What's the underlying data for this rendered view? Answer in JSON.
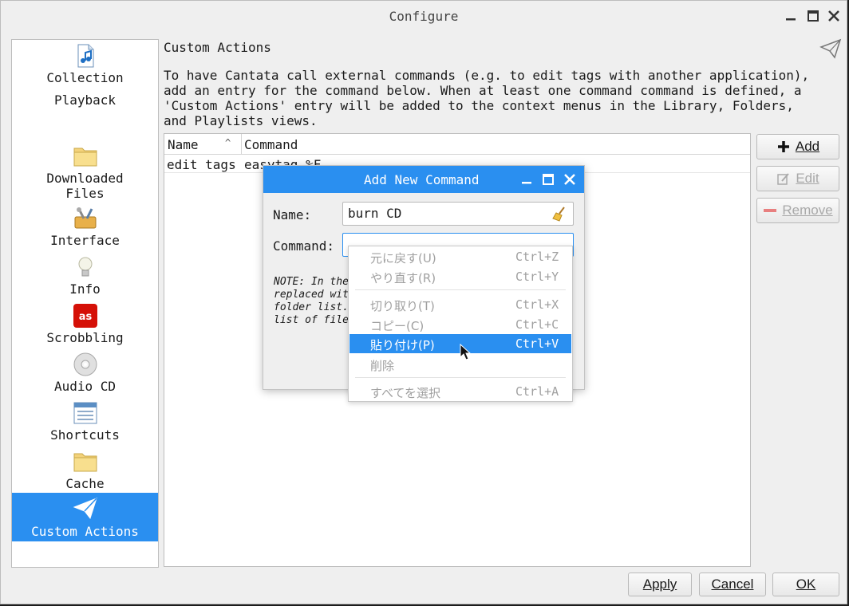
{
  "window": {
    "title": "Configure"
  },
  "sidebar": {
    "items": [
      {
        "label": "Collection",
        "icon": "music-file-icon"
      },
      {
        "label": "Playback",
        "icon": "playback-icon"
      },
      {
        "label": "Downloaded\nFiles",
        "icon": "folder-icon"
      },
      {
        "label": "Interface",
        "icon": "tools-icon"
      },
      {
        "label": "Info",
        "icon": "lightbulb-icon"
      },
      {
        "label": "Scrobbling",
        "icon": "lastfm-icon"
      },
      {
        "label": "Audio CD",
        "icon": "cd-icon"
      },
      {
        "label": "Shortcuts",
        "icon": "shortcuts-icon"
      },
      {
        "label": "Cache",
        "icon": "folder-icon"
      },
      {
        "label": "Custom Actions",
        "icon": "paper-plane-icon"
      }
    ]
  },
  "page": {
    "title": "Custom Actions",
    "description": [
      "To have Cantata call external commands (e.g. to edit tags with another application),",
      "add an entry for the command below. When at least one command command is defined, a",
      "'Custom Actions' entry will be added to the context menus in the Library, Folders,",
      "and Playlists views."
    ]
  },
  "table": {
    "columns": [
      "Name",
      "Command"
    ],
    "rows": [
      {
        "name": "edit tags",
        "command": "easytag %F"
      }
    ]
  },
  "side_buttons": {
    "add": "Add",
    "edit": "Edit",
    "remove": "Remove"
  },
  "bottom_buttons": {
    "apply": "Apply",
    "cancel": "Cancel",
    "ok": "OK"
  },
  "dialog": {
    "title": "Add New Command",
    "name_label": "Name:",
    "name_value": "burn CD",
    "command_label": "Command:",
    "command_value": "",
    "note_lines": [
      "NOTE: In the",
      "replaced wit",
      "folder list.",
      "list of file"
    ]
  },
  "context_menu": {
    "items": [
      {
        "label": "元に戻す(U)",
        "shortcut": "Ctrl+Z"
      },
      {
        "label": "やり直す(R)",
        "shortcut": "Ctrl+Y"
      },
      {
        "label": "切り取り(T)",
        "shortcut": "Ctrl+X"
      },
      {
        "label": "コピー(C)",
        "shortcut": "Ctrl+C"
      },
      {
        "label": "貼り付け(P)",
        "shortcut": "Ctrl+V"
      },
      {
        "label": "削除",
        "shortcut": ""
      },
      {
        "label": "すべてを選択",
        "shortcut": "Ctrl+A"
      }
    ],
    "highlighted": "貼り付け(P)"
  },
  "colors": {
    "accent": "#2a8ff0",
    "window_bg": "#efefef",
    "disabled_text": "#a0a0a0"
  }
}
